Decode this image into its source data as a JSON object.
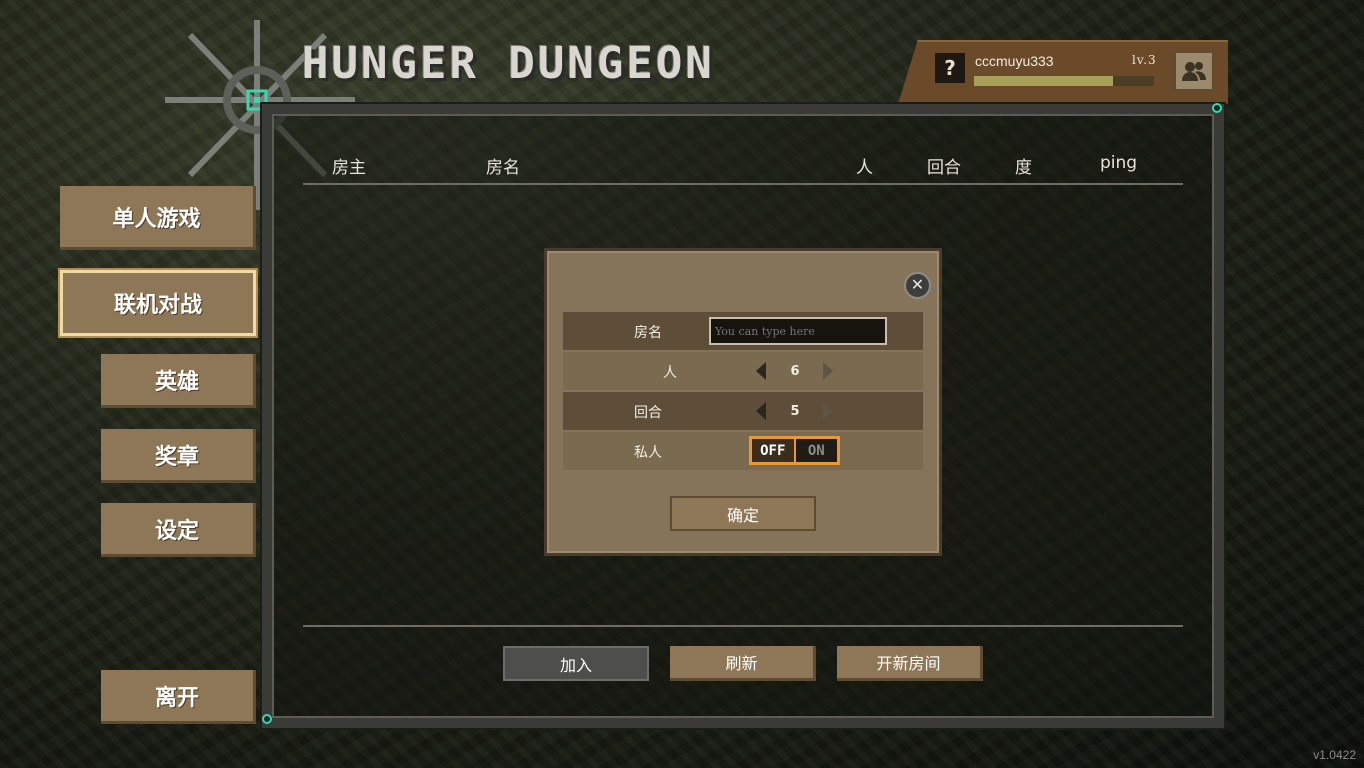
{
  "game": {
    "title": "HUNGER DUNGEON",
    "version": "v1.0422"
  },
  "player": {
    "name": "cccmuyu333",
    "level": "lv.3",
    "xp_fraction": 0.77,
    "help_label": "?"
  },
  "menu": {
    "single_player": "单人游戏",
    "online_battle": "联机对战",
    "heroes": "英雄",
    "medals": "奖章",
    "settings": "设定",
    "exit": "离开"
  },
  "room_list": {
    "columns": {
      "host": "房主",
      "room_name": "房名",
      "players": "人",
      "rounds": "回合",
      "difficulty": "度",
      "ping": "ping"
    },
    "join_label": "加入",
    "refresh_label": "刷新",
    "new_room_label": "开新房间"
  },
  "create_room_dialog": {
    "room_name_label": "房名",
    "room_name_placeholder": "You can type here",
    "players_label": "人",
    "players_value": "6",
    "rounds_label": "回合",
    "rounds_value": "5",
    "private_label": "私人",
    "toggle_off": "OFF",
    "toggle_on": "ON",
    "confirm_label": "确定",
    "close_glyph": "✕"
  },
  "colors": {
    "button": "#8d7757",
    "accent": "#e5993a",
    "frame_gem": "#39d6b0"
  }
}
